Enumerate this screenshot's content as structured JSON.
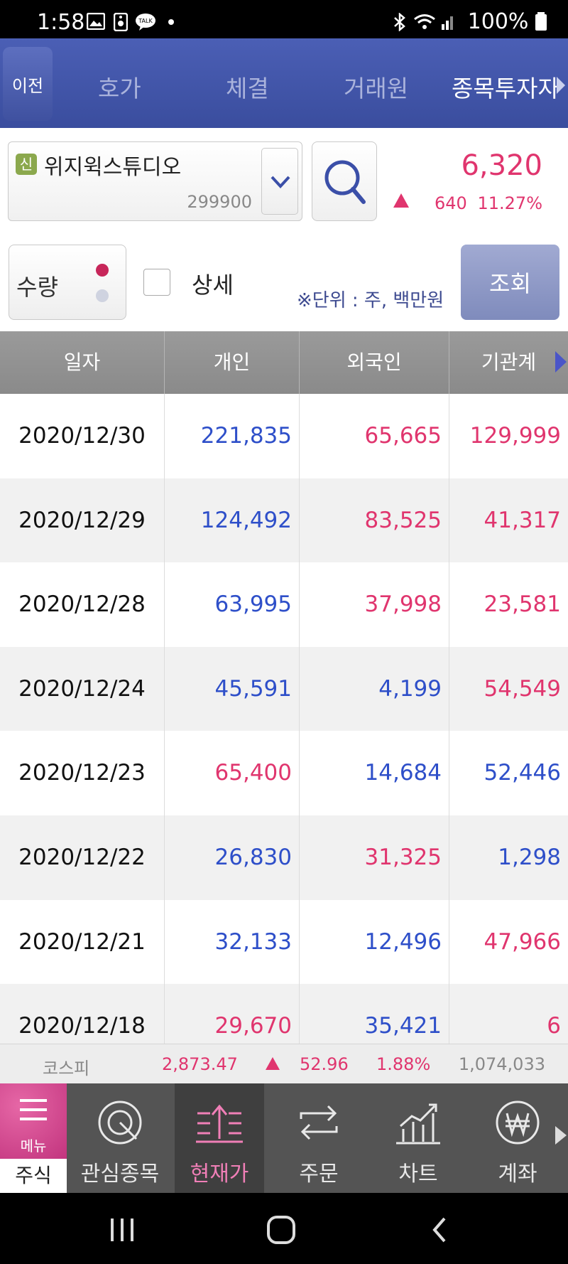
{
  "status_bar": {
    "time": "1:58",
    "battery": "100%"
  },
  "tabs": {
    "back_label": "이전",
    "items": [
      {
        "label": "호가"
      },
      {
        "label": "체결"
      },
      {
        "label": "거래원"
      },
      {
        "label": "종목투자자"
      }
    ]
  },
  "stock": {
    "badge": "신",
    "name": "위지윅스튜디오",
    "code": "299900",
    "price": "6,320",
    "change": "640",
    "change_pct": "11.27%",
    "up_color": "#e0356e",
    "down_color": "#2e4fc9"
  },
  "filters": {
    "quantity_label": "수량",
    "detail_label": "상세",
    "unit_note": "※단위 : 주, 백만원",
    "query_label": "조회"
  },
  "table": {
    "headers": [
      "일자",
      "개인",
      "외국인",
      "기관계"
    ],
    "rows": [
      {
        "date": "2020/12/30",
        "individual": "221,835",
        "individual_dir": "neg",
        "foreign": "65,665",
        "foreign_dir": "pos",
        "institution": "129,999",
        "institution_dir": "pos"
      },
      {
        "date": "2020/12/29",
        "individual": "124,492",
        "individual_dir": "neg",
        "foreign": "83,525",
        "foreign_dir": "pos",
        "institution": "41,317",
        "institution_dir": "pos"
      },
      {
        "date": "2020/12/28",
        "individual": "63,995",
        "individual_dir": "neg",
        "foreign": "37,998",
        "foreign_dir": "pos",
        "institution": "23,581",
        "institution_dir": "pos"
      },
      {
        "date": "2020/12/24",
        "individual": "45,591",
        "individual_dir": "neg",
        "foreign": "4,199",
        "foreign_dir": "neg",
        "institution": "54,549",
        "institution_dir": "pos"
      },
      {
        "date": "2020/12/23",
        "individual": "65,400",
        "individual_dir": "pos",
        "foreign": "14,684",
        "foreign_dir": "neg",
        "institution": "52,446",
        "institution_dir": "neg"
      },
      {
        "date": "2020/12/22",
        "individual": "26,830",
        "individual_dir": "neg",
        "foreign": "31,325",
        "foreign_dir": "pos",
        "institution": "1,298",
        "institution_dir": "neg"
      },
      {
        "date": "2020/12/21",
        "individual": "32,133",
        "individual_dir": "neg",
        "foreign": "12,496",
        "foreign_dir": "neg",
        "institution": "47,966",
        "institution_dir": "pos"
      },
      {
        "date": "2020/12/18",
        "individual": "29,670",
        "individual_dir": "pos",
        "foreign": "35,421",
        "foreign_dir": "neg",
        "institution": "6",
        "institution_dir": "pos"
      }
    ]
  },
  "index_bar": {
    "name": "코스피",
    "value": "2,873.47",
    "change": "52.96",
    "change_pct": "1.88%",
    "volume": "1,074,033"
  },
  "bottom_nav": {
    "menu_label": "메뉴",
    "stock_label": "주식",
    "items": [
      {
        "label": "관심종목",
        "icon": "target-icon"
      },
      {
        "label": "현재가",
        "icon": "current-price-icon"
      },
      {
        "label": "주문",
        "icon": "order-icon"
      },
      {
        "label": "차트",
        "icon": "chart-icon"
      },
      {
        "label": "계좌",
        "icon": "won-icon"
      }
    ]
  }
}
